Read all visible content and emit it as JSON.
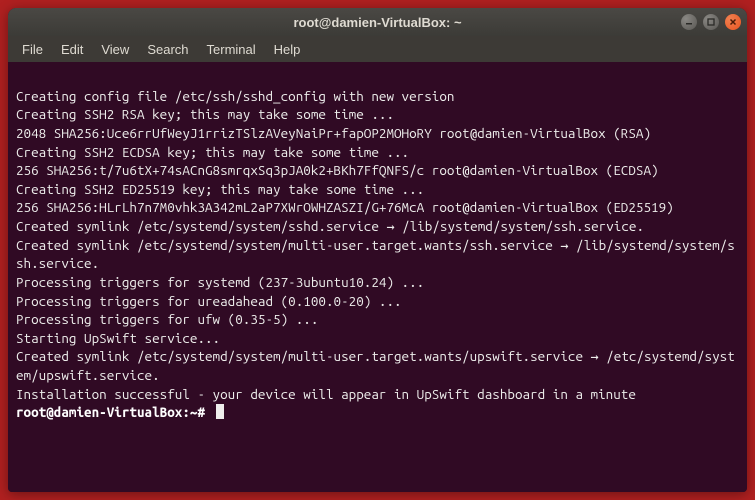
{
  "window": {
    "title": "root@damien-VirtualBox: ~"
  },
  "menubar": {
    "items": [
      "File",
      "Edit",
      "View",
      "Search",
      "Terminal",
      "Help"
    ]
  },
  "terminal": {
    "lines": [
      "",
      "Creating config file /etc/ssh/sshd_config with new version",
      "Creating SSH2 RSA key; this may take some time ...",
      "2048 SHA256:Uce6rrUfWeyJ1rrizTSlzAVeyNaiPr+fapOP2MOHoRY root@damien-VirtualBox (RSA)",
      "Creating SSH2 ECDSA key; this may take some time ...",
      "256 SHA256:t/7u6tX+74sACnG8smrqxSq3pJA0k2+BKh7FfQNFS/c root@damien-VirtualBox (ECDSA)",
      "Creating SSH2 ED25519 key; this may take some time ...",
      "256 SHA256:HLrLh7n7M0vhk3A342mL2aP7XWrOWHZASZI/G+76McA root@damien-VirtualBox (ED25519)",
      "Created symlink /etc/systemd/system/sshd.service → /lib/systemd/system/ssh.service.",
      "Created symlink /etc/systemd/system/multi-user.target.wants/ssh.service → /lib/systemd/system/ssh.service.",
      "Processing triggers for systemd (237-3ubuntu10.24) ...",
      "Processing triggers for ureadahead (0.100.0-20) ...",
      "Processing triggers for ufw (0.35-5) ...",
      "Starting UpSwift service...",
      "Created symlink /etc/systemd/system/multi-user.target.wants/upswift.service → /etc/systemd/system/upswift.service.",
      "Installation successful - your device will appear in UpSwift dashboard in a minute"
    ],
    "prompt": "root@damien-VirtualBox:~# "
  }
}
